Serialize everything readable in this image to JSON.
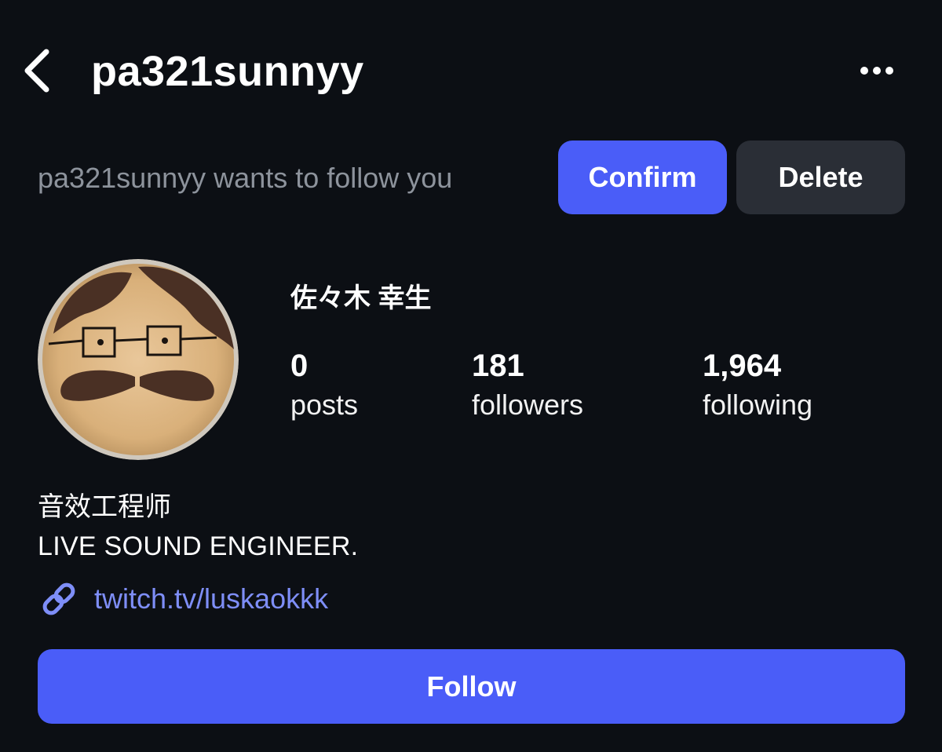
{
  "header": {
    "username": "pa321sunnyy",
    "back_icon": "chevron-left-icon",
    "more_icon": "more-horizontal-icon"
  },
  "request": {
    "text": "pa321sunnyy wants to follow you",
    "confirm_label": "Confirm",
    "delete_label": "Delete"
  },
  "profile": {
    "display_name": "佐々木 幸生",
    "avatar_icon": "avatar-cookie-face",
    "stats": {
      "posts": {
        "value": "0",
        "label": "posts"
      },
      "followers": {
        "value": "181",
        "label": "followers"
      },
      "following": {
        "value": "1,964",
        "label": "following"
      }
    }
  },
  "bio": {
    "line1": "音效工程师",
    "line2": "LIVE SOUND ENGINEER.",
    "link_text": "twitch.tv/luskaokkk",
    "link_icon": "link-icon"
  },
  "actions": {
    "follow_label": "Follow"
  },
  "colors": {
    "background": "#0c0f14",
    "accent": "#4a5df8",
    "secondary_button": "#2a2e36",
    "link": "#7e8ef7",
    "muted_text": "#8d939c"
  }
}
